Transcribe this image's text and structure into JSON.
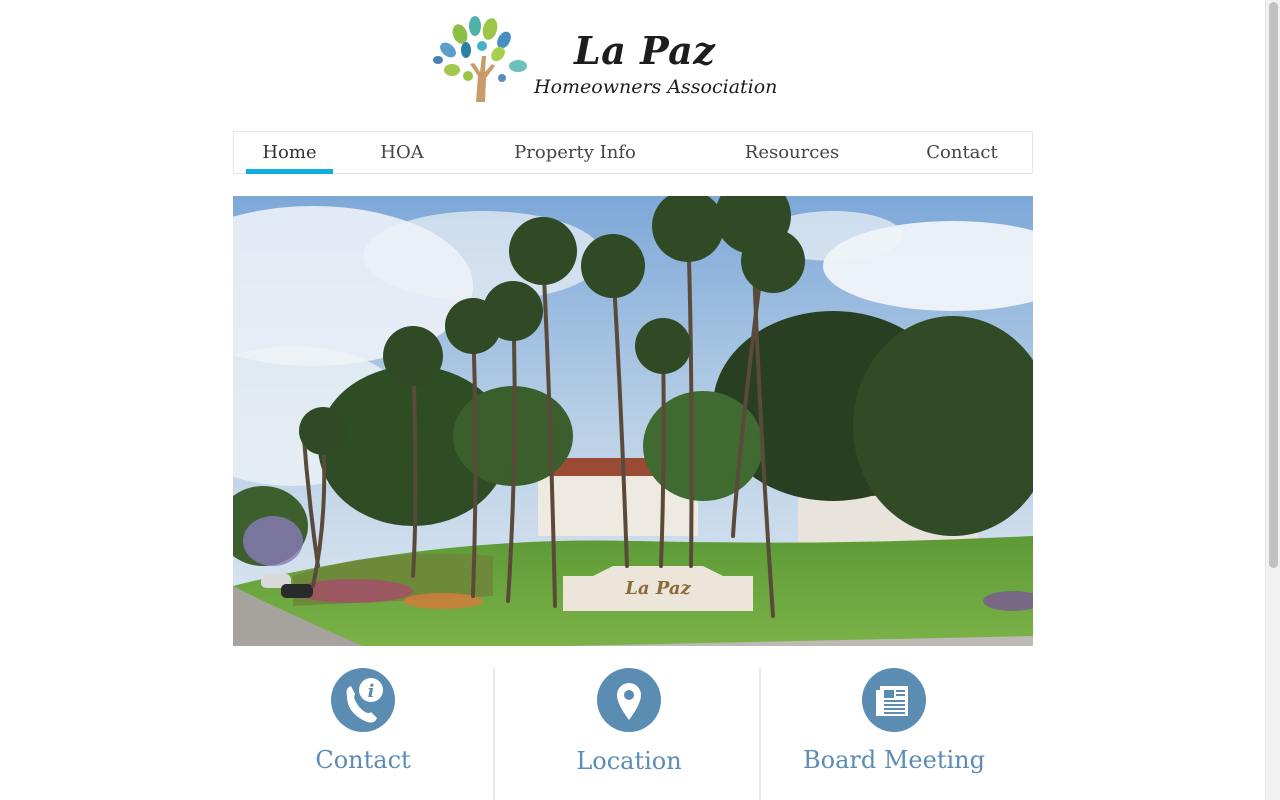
{
  "brand": {
    "name": "La Paz",
    "tagline": "Homeowners Association"
  },
  "nav": {
    "items": [
      {
        "label": "Home",
        "active": true
      },
      {
        "label": "HOA",
        "active": false
      },
      {
        "label": "Property Info",
        "active": false
      },
      {
        "label": "Resources",
        "active": false
      },
      {
        "label": "Contact",
        "active": false
      }
    ]
  },
  "hero": {
    "icon": "palm-trees-entrance-photo",
    "sign_text": "La Paz"
  },
  "features": [
    {
      "label": "Contact",
      "icon": "phone-info-icon"
    },
    {
      "label": "Location",
      "icon": "map-pin-icon"
    },
    {
      "label": "Board Meeting",
      "icon": "newspaper-icon"
    }
  ],
  "colors": {
    "accent": "#10aee0",
    "feature_blue": "#5b8cb2"
  }
}
